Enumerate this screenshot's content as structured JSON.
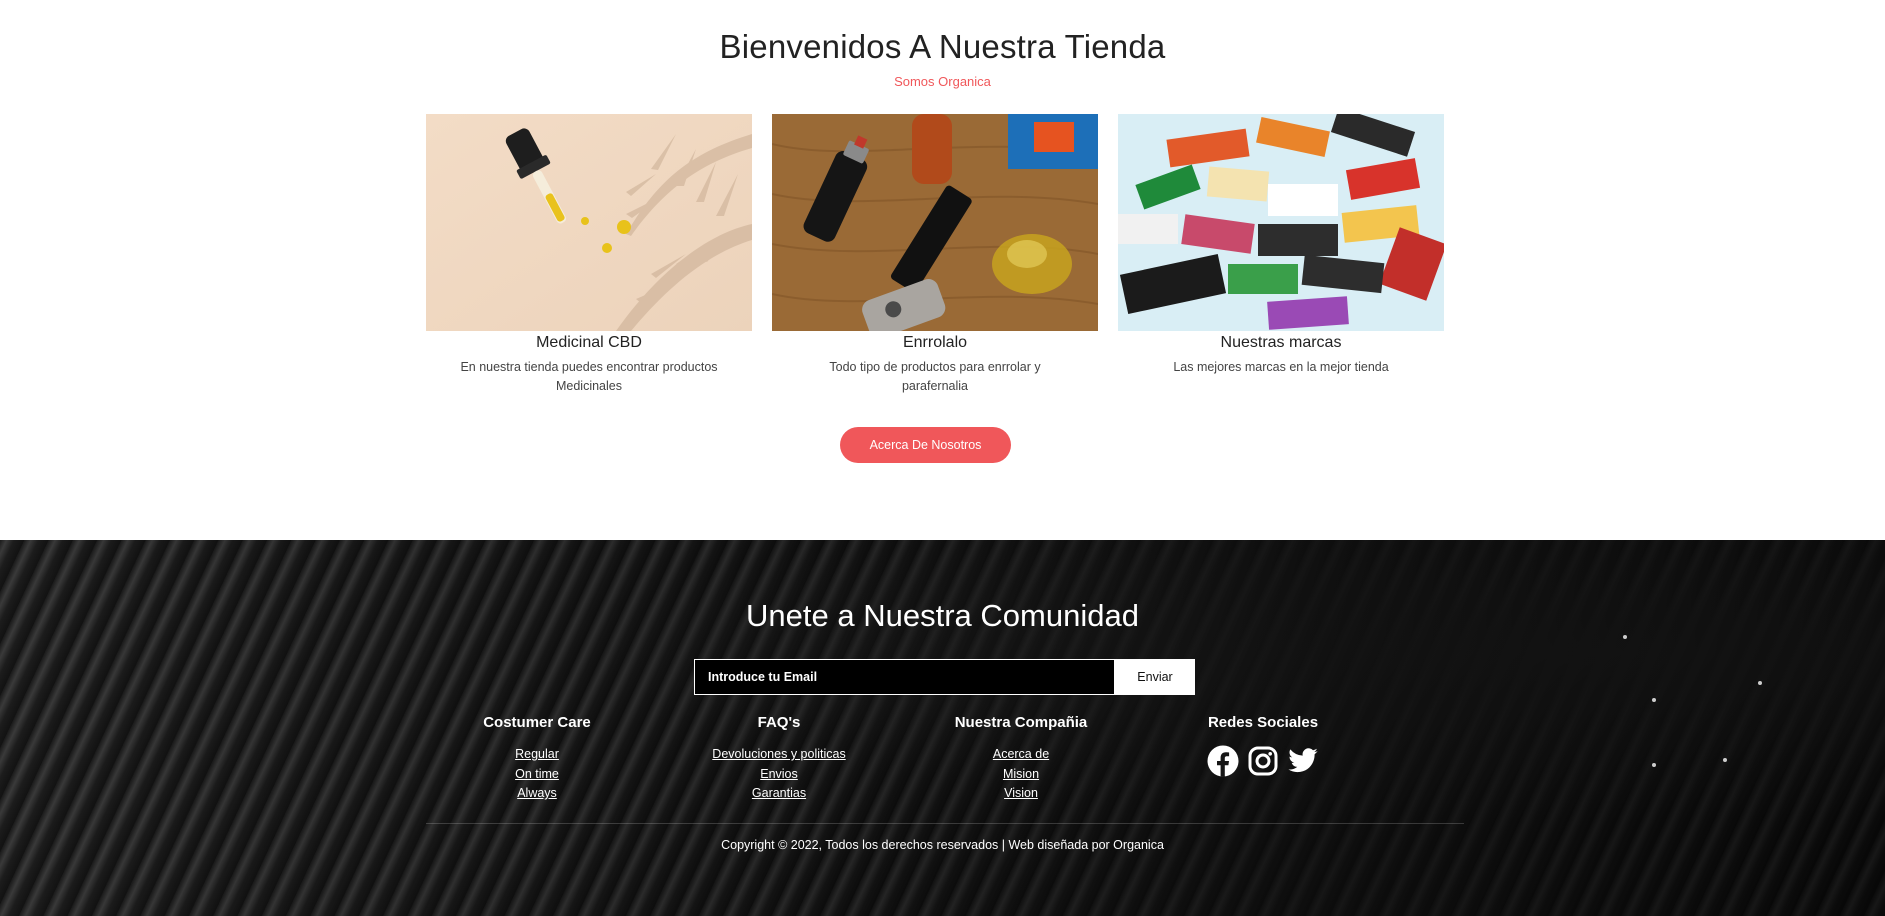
{
  "welcome": {
    "title": "Bienvenidos A Nuestra Tienda",
    "subtitle": "Somos Organica",
    "cards": [
      {
        "title": "Medicinal CBD",
        "description": "En nuestra tienda puedes encontrar productos Medicinales"
      },
      {
        "title": "Enrrolalo",
        "description": "Todo tipo de productos para enrrolar y parafernalia"
      },
      {
        "title": "Nuestras marcas",
        "description": "Las mejores marcas en la mejor tienda"
      }
    ],
    "about_button": "Acerca De Nosotros"
  },
  "footer": {
    "community_title": "Unete a Nuestra Comunidad",
    "email_placeholder": "Introduce tu Email",
    "send_button": "Enviar",
    "columns": [
      {
        "heading": "Costumer Care",
        "links": [
          "Regular",
          "On time",
          "Always"
        ]
      },
      {
        "heading": "FAQ's",
        "links": [
          "Devoluciones y politicas",
          "Envios",
          "Garantias"
        ]
      },
      {
        "heading": "Nuestra Compañia",
        "links": [
          "Acerca de",
          "Mision",
          "Vision"
        ]
      }
    ],
    "social": {
      "heading": "Redes Sociales",
      "icons": [
        "facebook-icon",
        "instagram-icon",
        "twitter-icon"
      ]
    },
    "copyright": "Copyright © 2022, Todos los derechos reservados | Web diseñada por Organica"
  },
  "colors": {
    "accent": "#f0575a",
    "footer_bg": "#161616",
    "text": "#222222"
  }
}
